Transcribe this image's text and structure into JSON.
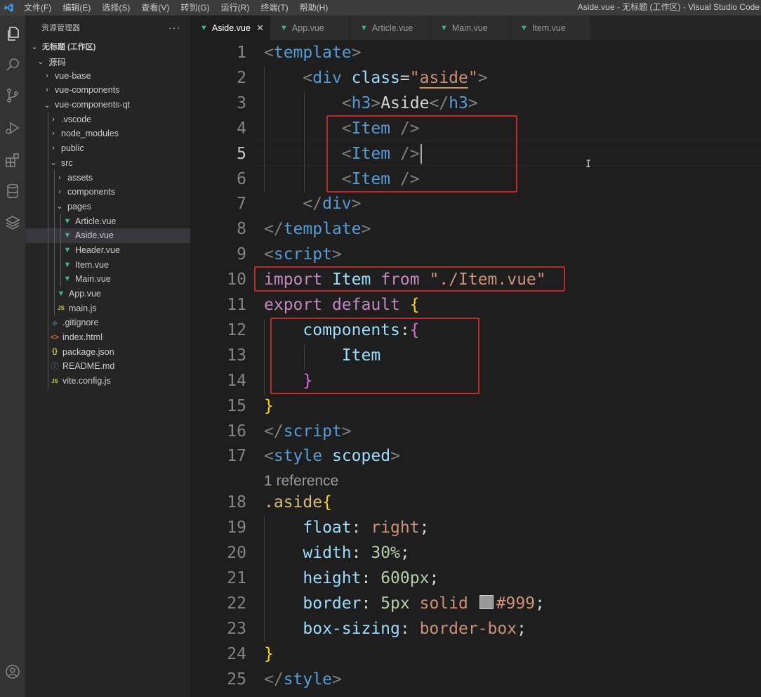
{
  "titlebar": {
    "menus": [
      "文件(F)",
      "编辑(E)",
      "选择(S)",
      "查看(V)",
      "转到(G)",
      "运行(R)",
      "终端(T)",
      "帮助(H)"
    ],
    "window_title": "Aside.vue - 无标题 (工作区) - Visual Studio Code"
  },
  "activitybar": {
    "icons": [
      "explorer-icon",
      "search-icon",
      "source-control-icon",
      "run-debug-icon",
      "extensions-icon",
      "database-icon",
      "layers-icon",
      "account-icon"
    ]
  },
  "sidebar": {
    "title": "资源管理器",
    "more": "···",
    "tree": [
      {
        "label": "无标题 (工作区)",
        "depth": 0,
        "kind": "folder-open",
        "bold": true
      },
      {
        "label": "源码",
        "depth": 1,
        "kind": "folder-open"
      },
      {
        "label": "vue-base",
        "depth": 2,
        "kind": "folder"
      },
      {
        "label": "vue-components",
        "depth": 2,
        "kind": "folder"
      },
      {
        "label": "vue-components-qt",
        "depth": 2,
        "kind": "folder-open"
      },
      {
        "label": ".vscode",
        "depth": 3,
        "kind": "folder"
      },
      {
        "label": "node_modules",
        "depth": 3,
        "kind": "folder"
      },
      {
        "label": "public",
        "depth": 3,
        "kind": "folder"
      },
      {
        "label": "src",
        "depth": 3,
        "kind": "folder-open"
      },
      {
        "label": "assets",
        "depth": 4,
        "kind": "folder"
      },
      {
        "label": "components",
        "depth": 4,
        "kind": "folder"
      },
      {
        "label": "pages",
        "depth": 4,
        "kind": "folder-open"
      },
      {
        "label": "Article.vue",
        "depth": 5,
        "kind": "vue"
      },
      {
        "label": "Aside.vue",
        "depth": 5,
        "kind": "vue",
        "selected": true
      },
      {
        "label": "Header.vue",
        "depth": 5,
        "kind": "vue"
      },
      {
        "label": "Item.vue",
        "depth": 5,
        "kind": "vue"
      },
      {
        "label": "Main.vue",
        "depth": 5,
        "kind": "vue"
      },
      {
        "label": "App.vue",
        "depth": 4,
        "kind": "vue"
      },
      {
        "label": "main.js",
        "depth": 4,
        "kind": "js"
      },
      {
        "label": ".gitignore",
        "depth": 3,
        "kind": "git"
      },
      {
        "label": "index.html",
        "depth": 3,
        "kind": "html"
      },
      {
        "label": "package.json",
        "depth": 3,
        "kind": "json"
      },
      {
        "label": "README.md",
        "depth": 3,
        "kind": "info"
      },
      {
        "label": "vite.config.js",
        "depth": 3,
        "kind": "js"
      }
    ]
  },
  "tabs": [
    {
      "label": "Aside.vue",
      "active": true,
      "close": "✕"
    },
    {
      "label": "App.vue"
    },
    {
      "label": "Article.vue"
    },
    {
      "label": "Main.vue"
    },
    {
      "label": "Item.vue"
    }
  ],
  "editor": {
    "current_line": 5,
    "codelens": "1 reference",
    "lines": [
      {
        "n": "1",
        "tokens": [
          [
            "p",
            "<"
          ],
          [
            "t",
            "template"
          ],
          [
            "p",
            ">"
          ]
        ]
      },
      {
        "n": "2",
        "tokens": [
          [
            "w",
            "    "
          ],
          [
            "p",
            "<"
          ],
          [
            "t",
            "div"
          ],
          [
            "w",
            " "
          ],
          [
            "a",
            "class"
          ],
          [
            "w",
            "="
          ],
          [
            "s",
            "\""
          ],
          [
            "s u",
            "aside"
          ],
          [
            "s",
            "\""
          ],
          [
            "p",
            ">"
          ]
        ]
      },
      {
        "n": "3",
        "tokens": [
          [
            "w",
            "        "
          ],
          [
            "p",
            "<"
          ],
          [
            "t",
            "h3"
          ],
          [
            "p",
            ">"
          ],
          [
            "w",
            "Aside"
          ],
          [
            "p",
            "</"
          ],
          [
            "t",
            "h3"
          ],
          [
            "p",
            ">"
          ]
        ]
      },
      {
        "n": "4",
        "tokens": [
          [
            "w",
            "        "
          ],
          [
            "p",
            "<"
          ],
          [
            "t",
            "Item"
          ],
          [
            "w",
            " "
          ],
          [
            "p",
            "/>"
          ]
        ]
      },
      {
        "n": "5",
        "tokens": [
          [
            "w",
            "        "
          ],
          [
            "p",
            "<"
          ],
          [
            "t",
            "Item"
          ],
          [
            "w",
            " "
          ],
          [
            "p",
            "/>"
          ]
        ]
      },
      {
        "n": "6",
        "tokens": [
          [
            "w",
            "        "
          ],
          [
            "p",
            "<"
          ],
          [
            "t",
            "Item"
          ],
          [
            "w",
            " "
          ],
          [
            "p",
            "/>"
          ]
        ]
      },
      {
        "n": "7",
        "tokens": [
          [
            "w",
            "    "
          ],
          [
            "p",
            "</"
          ],
          [
            "t",
            "div"
          ],
          [
            "p",
            ">"
          ]
        ]
      },
      {
        "n": "8",
        "tokens": [
          [
            "p",
            "</"
          ],
          [
            "t",
            "template"
          ],
          [
            "p",
            ">"
          ]
        ]
      },
      {
        "n": "9",
        "tokens": [
          [
            "p",
            "<"
          ],
          [
            "t",
            "script"
          ],
          [
            "p",
            ">"
          ]
        ]
      },
      {
        "n": "10",
        "tokens": [
          [
            "k",
            "import"
          ],
          [
            "w",
            " "
          ],
          [
            "v",
            "Item"
          ],
          [
            "w",
            " "
          ],
          [
            "k",
            "from"
          ],
          [
            "w",
            " "
          ],
          [
            "s",
            "\"./Item.vue\""
          ]
        ]
      },
      {
        "n": "11",
        "tokens": [
          [
            "k",
            "export"
          ],
          [
            "w",
            " "
          ],
          [
            "k",
            "default"
          ],
          [
            "w",
            " "
          ],
          [
            "br1",
            "{"
          ]
        ]
      },
      {
        "n": "12",
        "tokens": [
          [
            "w",
            "    "
          ],
          [
            "v",
            "components"
          ],
          [
            "w",
            ":"
          ],
          [
            "br2",
            "{"
          ]
        ]
      },
      {
        "n": "13",
        "tokens": [
          [
            "w",
            "        "
          ],
          [
            "v",
            "Item"
          ]
        ]
      },
      {
        "n": "14",
        "tokens": [
          [
            "w",
            "    "
          ],
          [
            "br2",
            "}"
          ]
        ]
      },
      {
        "n": "15",
        "tokens": [
          [
            "br1",
            "}"
          ]
        ]
      },
      {
        "n": "16",
        "tokens": [
          [
            "p",
            "</"
          ],
          [
            "t",
            "script"
          ],
          [
            "p",
            ">"
          ]
        ]
      },
      {
        "n": "17",
        "tokens": [
          [
            "p",
            "<"
          ],
          [
            "t",
            "style"
          ],
          [
            "w",
            " "
          ],
          [
            "a",
            "scoped"
          ],
          [
            "p",
            ">"
          ]
        ]
      },
      {
        "n": "18",
        "tokens": [
          [
            "sel",
            ".aside"
          ],
          [
            "br1",
            "{"
          ]
        ]
      },
      {
        "n": "19",
        "tokens": [
          [
            "w",
            "    "
          ],
          [
            "a",
            "float"
          ],
          [
            "w",
            ": "
          ],
          [
            "s",
            "right"
          ],
          [
            "w",
            ";"
          ]
        ]
      },
      {
        "n": "20",
        "tokens": [
          [
            "w",
            "    "
          ],
          [
            "a",
            "width"
          ],
          [
            "w",
            ": "
          ],
          [
            "n",
            "30%"
          ],
          [
            "w",
            ";"
          ]
        ]
      },
      {
        "n": "21",
        "tokens": [
          [
            "w",
            "    "
          ],
          [
            "a",
            "height"
          ],
          [
            "w",
            ": "
          ],
          [
            "n",
            "600px"
          ],
          [
            "w",
            ";"
          ]
        ]
      },
      {
        "n": "22",
        "tokens": [
          [
            "w",
            "    "
          ],
          [
            "a",
            "border"
          ],
          [
            "w",
            ": "
          ],
          [
            "n",
            "5px"
          ],
          [
            "w",
            " "
          ],
          [
            "s",
            "solid"
          ],
          [
            "w",
            " "
          ],
          [
            "swatch",
            ""
          ],
          [
            "s",
            "#999"
          ],
          [
            "w",
            ";"
          ]
        ]
      },
      {
        "n": "23",
        "tokens": [
          [
            "w",
            "    "
          ],
          [
            "a",
            "box-sizing"
          ],
          [
            "w",
            ": "
          ],
          [
            "s",
            "border-box"
          ],
          [
            "w",
            ";"
          ]
        ]
      },
      {
        "n": "24",
        "tokens": [
          [
            "br1",
            "}"
          ]
        ]
      },
      {
        "n": "25",
        "tokens": [
          [
            "p",
            "</"
          ],
          [
            "t",
            "style"
          ],
          [
            "p",
            ">"
          ]
        ]
      }
    ]
  },
  "colors": {
    "highlight_box": "#c0282d",
    "vue_green": "#41b883",
    "swatch": "#999999"
  }
}
